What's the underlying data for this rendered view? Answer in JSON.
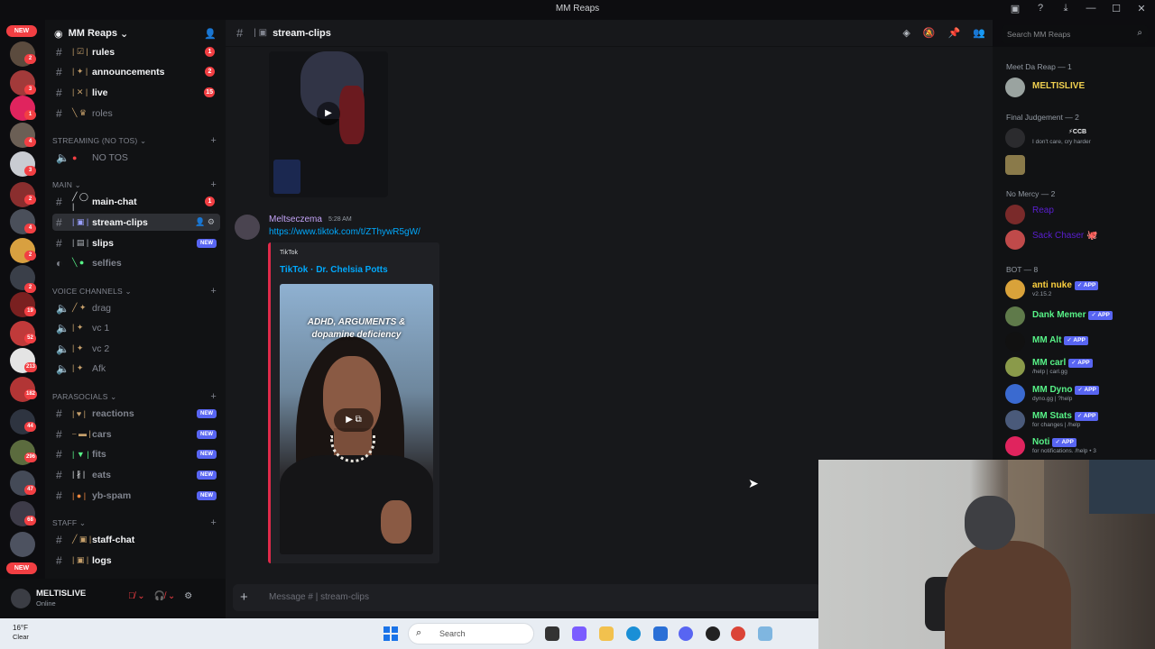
{
  "window": {
    "title": "MM Reaps"
  },
  "servers": {
    "new_top": "NEW",
    "new_bottom": "NEW",
    "badges": [
      "2",
      "3",
      "1",
      "4",
      "3",
      "2",
      "4",
      "2",
      "2",
      "19",
      "52",
      "213",
      "182",
      "44",
      "296",
      "47",
      "68"
    ]
  },
  "guild": {
    "name": "MM Reaps"
  },
  "channels": {
    "top": [
      {
        "name": "rules",
        "badge": "1"
      },
      {
        "name": "announcements",
        "badge": "2"
      },
      {
        "name": "live",
        "badge": "15"
      },
      {
        "name": "roles",
        "badge": ""
      }
    ],
    "streaming_category": "STREAMING (NO TOS)",
    "streaming": [
      {
        "name": "NO TOS"
      }
    ],
    "main_category": "MAIN",
    "main": [
      {
        "name": "main-chat",
        "badge": "1"
      },
      {
        "name": "stream-clips",
        "badge": ""
      },
      {
        "name": "slips",
        "tag": "NEW"
      },
      {
        "name": "selfies",
        "tag": ""
      }
    ],
    "voice_category": "VOICE CHANNELS",
    "voice": [
      {
        "name": "drag"
      },
      {
        "name": "vc 1"
      },
      {
        "name": "vc 2"
      },
      {
        "name": "Afk"
      }
    ],
    "parasocials_category": "PARASOCIALS",
    "parasocials": [
      {
        "name": "reactions",
        "tag": "NEW"
      },
      {
        "name": "cars",
        "tag": "NEW"
      },
      {
        "name": "fits",
        "tag": "NEW"
      },
      {
        "name": "eats",
        "tag": "NEW"
      },
      {
        "name": "yb-spam",
        "tag": "NEW"
      }
    ],
    "staff_category": "STAFF",
    "staff": [
      {
        "name": "staff-chat"
      },
      {
        "name": "logs"
      }
    ]
  },
  "user": {
    "name": "MELTISLIVE",
    "status": "Online"
  },
  "chat": {
    "channel": "stream-clips",
    "search_placeholder": "Search MM Reaps",
    "message": {
      "author": "Meltseczema",
      "time": "5:28 AM",
      "link": "https://www.tiktok.com/t/ZThywR5gW/",
      "embed_provider": "TikTok",
      "embed_title": "TikTok · Dr. Chelsia Potts",
      "video_caption_1": "ADHD, ARGUMENTS &",
      "video_caption_2": "dopamine deficiency"
    },
    "input_placeholder": "Message # | stream-clips"
  },
  "members": {
    "cat1": "Meet Da Reap — 1",
    "m1": "MELTISLIVE",
    "cat2": "Final Judgement — 2",
    "m2_tag": "⚡CCB",
    "m2_status": "I don't care, cry harder",
    "cat3": "No Mercy — 2",
    "m4": "Reap",
    "m5": "Sack Chaser 🐙",
    "cat4": "BOT — 8",
    "bots": [
      {
        "name": "anti nuke",
        "sub": "v2.15.2",
        "color": "#ffd23f"
      },
      {
        "name": "Dank Memer",
        "sub": "",
        "color": "#57f287"
      },
      {
        "name": "MM Alt",
        "sub": "",
        "color": "#57f287"
      },
      {
        "name": "MM carl",
        "sub": "/help | carl.gg",
        "color": "#57f287"
      },
      {
        "name": "MM Dyno",
        "sub": "dyno.gg | ?help",
        "color": "#57f287"
      },
      {
        "name": "MM Stats",
        "sub": "for changes | /help",
        "color": "#57f287"
      },
      {
        "name": "Noti",
        "sub": "for notifications. /help • 3",
        "color": "#57f287"
      }
    ],
    "app_tag": "APP"
  },
  "taskbar": {
    "temp": "16°F",
    "weather": "Clear",
    "search": "Search"
  }
}
